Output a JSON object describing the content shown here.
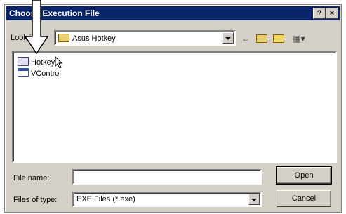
{
  "window": {
    "title": "Choose Execution File",
    "help_label": "?",
    "close_label": "×"
  },
  "toolbar": {
    "lookin_label": "Look in:",
    "lookin_value": "Asus Hotkey",
    "back_icon": "←",
    "up_icon": "📁",
    "newfolder_icon": "✱",
    "view_icon": "▦▾"
  },
  "files": [
    {
      "name": "Hotkey",
      "icon": "exe-icon"
    },
    {
      "name": "VControl",
      "icon": "exe-icon"
    }
  ],
  "form": {
    "filename_label": "File name:",
    "filename_value": "",
    "filetype_label": "Files of type:",
    "filetype_value": "EXE Files (*.exe)",
    "open_label": "Open",
    "cancel_label": "Cancel"
  }
}
